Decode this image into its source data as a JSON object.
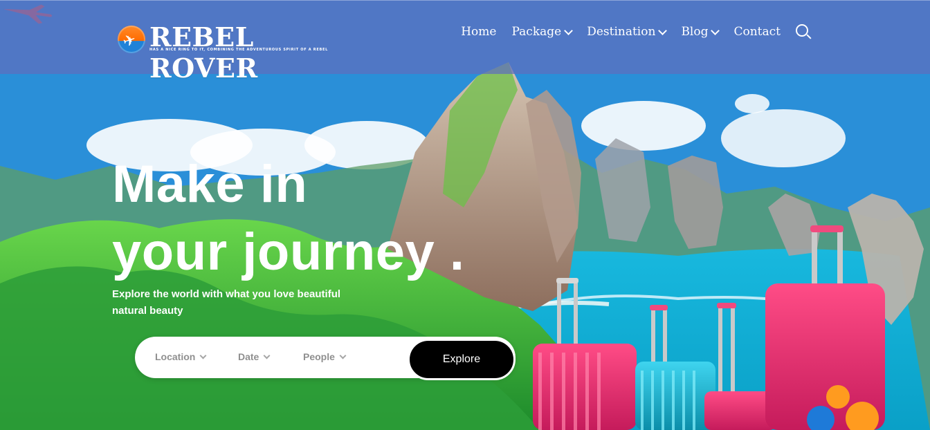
{
  "brand": {
    "name": "REBEL ROVER",
    "tagline": "HAS A NICE RING TO IT, COMBINING THE ADVENTUROUS SPIRIT OF A REBEL"
  },
  "nav": {
    "items": [
      {
        "label": "Home"
      },
      {
        "label": "Package"
      },
      {
        "label": "Destination"
      },
      {
        "label": "Blog"
      },
      {
        "label": "Contact"
      }
    ]
  },
  "hero": {
    "title_line1": "Make in",
    "title_line2": "your journey .",
    "subtitle": "Explore the world with what you love beautiful natural beauty"
  },
  "search": {
    "location_label": "Location",
    "date_label": "Date",
    "people_label": "People",
    "explore_label": "Explore"
  },
  "icons": {
    "search": "search-icon",
    "chevron": "chevron-down-icon",
    "logo": "plane-logo-icon"
  },
  "colors": {
    "overlay": "#606ebe",
    "button": "#000000",
    "accent_orange": "#ff6b00",
    "accent_blue": "#1f82d8"
  }
}
